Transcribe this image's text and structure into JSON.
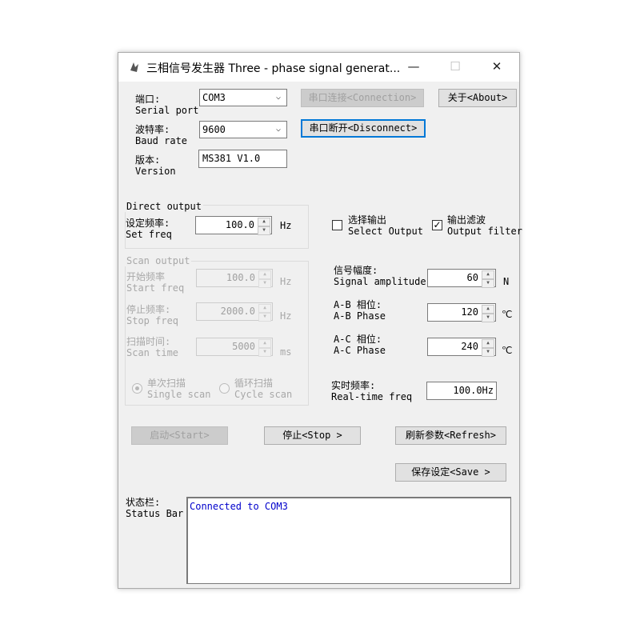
{
  "window": {
    "title": "三相信号发生器 Three - phase signal generat...",
    "minimize": "—",
    "maximize": "☐",
    "close": "✕"
  },
  "port": {
    "label_cn": "端口:",
    "label_en": "Serial port",
    "value": "COM3",
    "connect_button": "串口连接<Connection>",
    "about_button": "关于<About>"
  },
  "baud": {
    "label_cn": "波特率:",
    "label_en": "Baud rate",
    "value": "9600",
    "disconnect_button": "串口断开<Disconnect>"
  },
  "version": {
    "label_cn": "版本:",
    "label_en": "Version",
    "value": "MS381 V1.0"
  },
  "direct_output": {
    "title": "Direct output",
    "set_freq_cn": "设定频率:",
    "set_freq_en": "Set freq",
    "set_freq_value": "100.0",
    "unit": "Hz"
  },
  "select_output": {
    "label_cn": "选择输出",
    "label_en": "Select Output",
    "checked": false
  },
  "output_filter": {
    "label_cn": "输出滤波",
    "label_en": "Output filter",
    "checked": true
  },
  "scan_output": {
    "title": "Scan output",
    "start_cn": "开始频率",
    "start_en": "Start freq",
    "start_value": "100.0",
    "start_unit": "Hz",
    "stop_cn": "停止频率:",
    "stop_en": "Stop freq",
    "stop_value": "2000.0",
    "stop_unit": "Hz",
    "time_cn": "扫描时间:",
    "time_en": "Scan time",
    "time_value": "5000",
    "time_unit": "ms",
    "single_cn": "单次扫描",
    "single_en": "Single scan",
    "cycle_cn": "循环扫描",
    "cycle_en": "Cycle scan"
  },
  "amplitude": {
    "label_cn": "信号幅度:",
    "label_en": "Signal amplitude",
    "value": "60",
    "unit": "N"
  },
  "ab_phase": {
    "label_cn": "A-B 相位:",
    "label_en": "A-B Phase",
    "value": "120",
    "unit": "℃"
  },
  "ac_phase": {
    "label_cn": "A-C 相位:",
    "label_en": "A-C Phase",
    "value": "240",
    "unit": "℃"
  },
  "realtime": {
    "label_cn": "实时频率:",
    "label_en": "Real-time freq",
    "value": "100.0Hz"
  },
  "buttons": {
    "start": "启动<Start>",
    "stop": "停止<Stop >",
    "refresh": "刷新参数<Refresh>",
    "save": "保存设定<Save >"
  },
  "status_bar": {
    "label_cn": "状态栏:",
    "label_en": "Status Bar",
    "text": "Connected to COM3"
  },
  "colors": {
    "focus_border": "#0078d7",
    "status_text": "#0000cc"
  }
}
